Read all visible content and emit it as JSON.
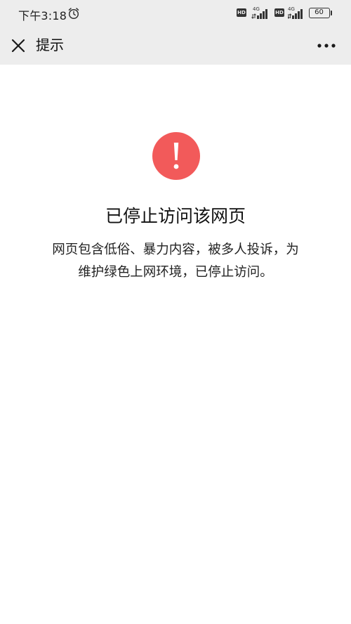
{
  "status_bar": {
    "time": "下午3:18",
    "sim1_badge": "HD",
    "sim1_network": "4G",
    "sim2_badge": "HD",
    "sim2_network": "4G",
    "battery": "60",
    "icons": [
      "alarm-icon",
      "signal-icon",
      "battery-icon"
    ]
  },
  "nav": {
    "title": "提示",
    "close_icon": "close-icon",
    "more_icon": "more-icon"
  },
  "content": {
    "heading": "已停止访问该网页",
    "message_line1": "网页包含低俗、暴力内容，被多人投诉，为",
    "message_line2": "维护绿色上网环境，已停止访问。",
    "icon": "exclamation-circle-icon"
  },
  "colors": {
    "warning": "#f25a5a",
    "header_bg": "#ededed",
    "page_bg": "#ffffff"
  }
}
